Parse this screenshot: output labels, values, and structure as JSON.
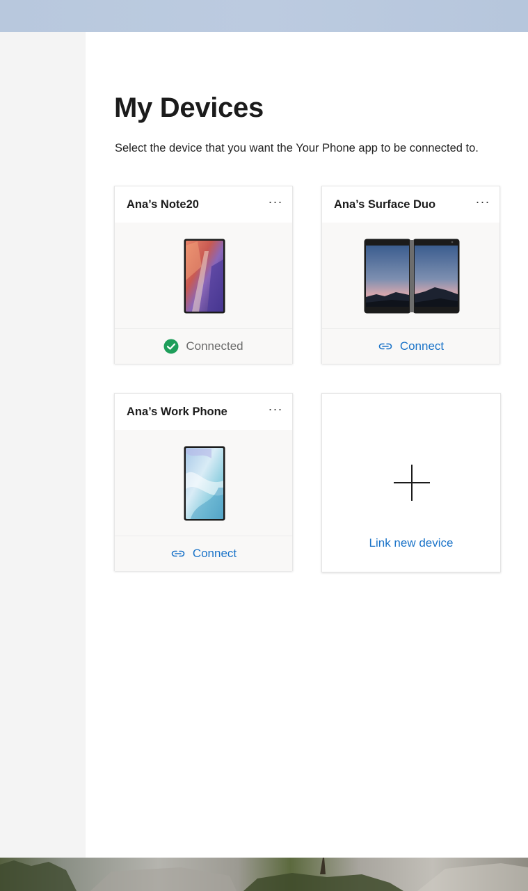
{
  "page": {
    "title": "My Devices",
    "subtitle": "Select the device that you want the Your Phone app to be connected to."
  },
  "devices": [
    {
      "name": "Ana’s Note20",
      "more_label": "···",
      "status": "connected",
      "action_label": "Connected",
      "image_icon": "phone-note20-icon"
    },
    {
      "name": "Ana’s Surface Duo",
      "more_label": "···",
      "status": "disconnected",
      "action_label": "Connect",
      "image_icon": "surface-duo-icon"
    },
    {
      "name": "Ana’s Work Phone",
      "more_label": "···",
      "status": "disconnected",
      "action_label": "Connect",
      "image_icon": "phone-work-icon"
    }
  ],
  "add_device": {
    "label": "Link new device",
    "icon": "plus-icon"
  },
  "colors": {
    "accent": "#1a73c8",
    "connected_green": "#1e9e5a",
    "panel_background": "#f9f8f7",
    "sidebar_background": "#f4f4f4"
  }
}
